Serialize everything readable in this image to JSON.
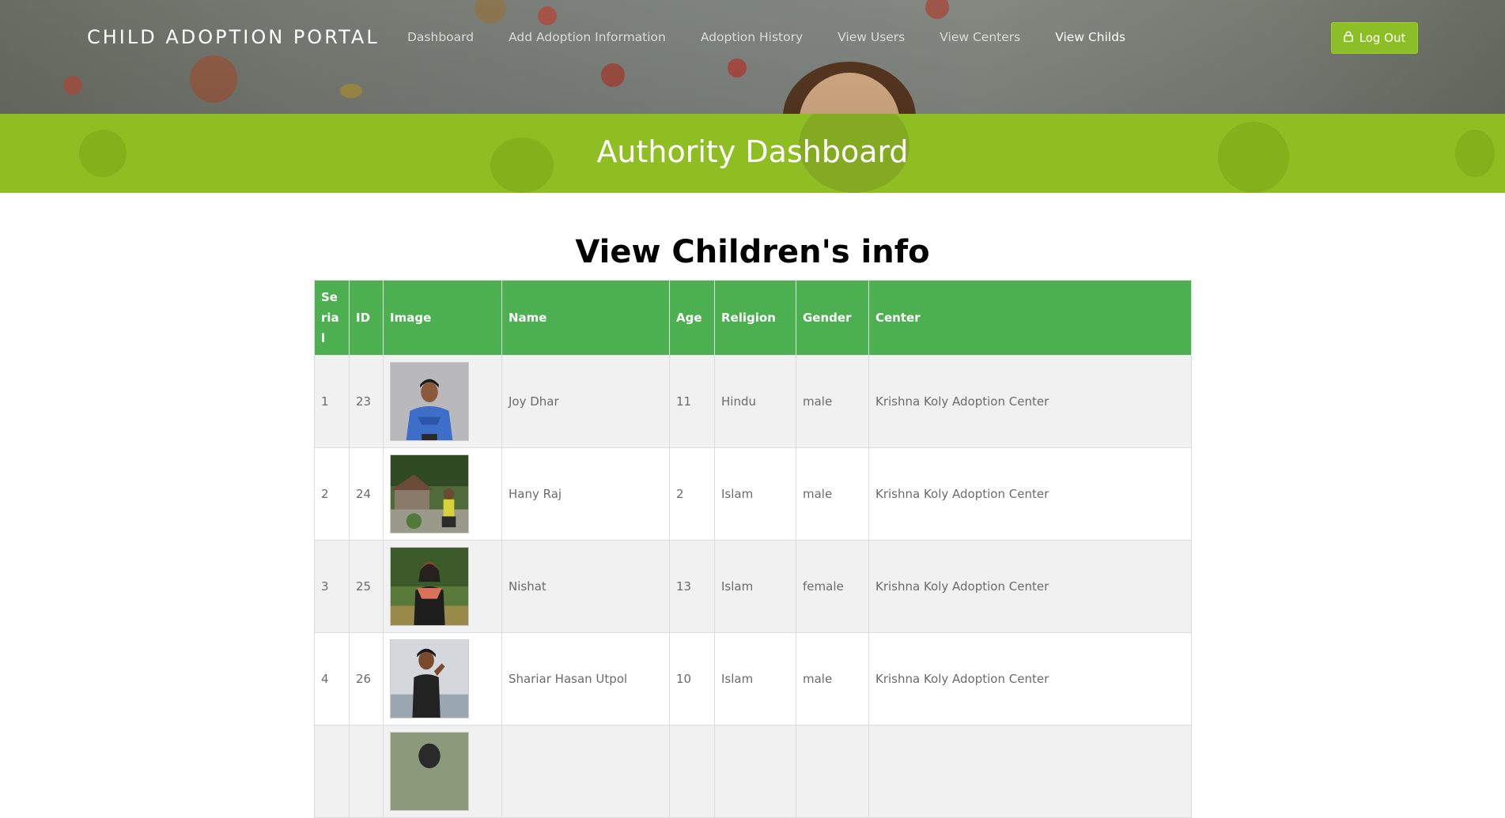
{
  "header": {
    "brand": "CHILD ADOPTION PORTAL",
    "nav": [
      {
        "label": "Dashboard",
        "active": false
      },
      {
        "label": "Add Adoption Information",
        "active": false
      },
      {
        "label": "Adoption History",
        "active": false
      },
      {
        "label": "View Users",
        "active": false
      },
      {
        "label": "View Centers",
        "active": false
      },
      {
        "label": "View Childs",
        "active": true
      }
    ],
    "logout_label": "Log Out",
    "logout_icon": "lock-icon"
  },
  "banner": {
    "title": "Authority Dashboard"
  },
  "main": {
    "title": "View Children's info",
    "columns": [
      "Serial",
      "ID",
      "Image",
      "Name",
      "Age",
      "Religion",
      "Gender",
      "Center"
    ],
    "rows": [
      {
        "serial": "1",
        "id": "23",
        "name": "Joy Dhar",
        "age": "11",
        "religion": "Hindu",
        "gender": "male",
        "center": "Krishna Koly Adoption Center"
      },
      {
        "serial": "2",
        "id": "24",
        "name": "Hany Raj",
        "age": "2",
        "religion": "Islam",
        "gender": "male",
        "center": "Krishna Koly Adoption Center"
      },
      {
        "serial": "3",
        "id": "25",
        "name": "Nishat",
        "age": "13",
        "religion": "Islam",
        "gender": "female",
        "center": "Krishna Koly Adoption Center"
      },
      {
        "serial": "4",
        "id": "26",
        "name": "Shariar Hasan Utpol",
        "age": "10",
        "religion": "Islam",
        "gender": "male",
        "center": "Krishna Koly Adoption Center"
      }
    ]
  },
  "colors": {
    "accent_green": "#8fbe22",
    "table_header_green": "#4caf50",
    "logout_green": "#8cbf25"
  }
}
